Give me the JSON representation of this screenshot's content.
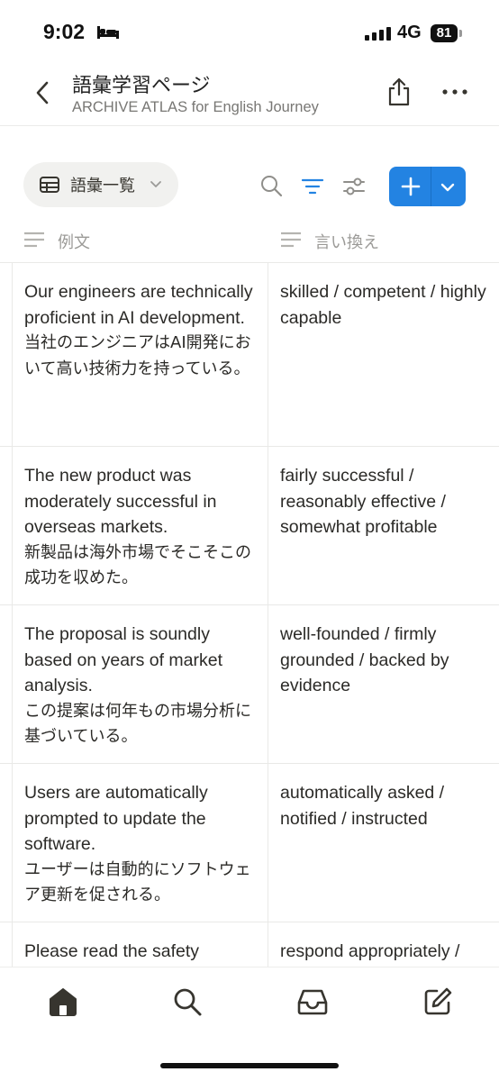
{
  "status_bar": {
    "time": "9:02",
    "network": "4G",
    "battery": "81"
  },
  "header": {
    "title": "語彙学習ページ",
    "subtitle": "ARCHIVE ATLAS for English Journey"
  },
  "view": {
    "name": "語彙一覧"
  },
  "columns": [
    {
      "label": "例文"
    },
    {
      "label": "言い換え"
    }
  ],
  "rows": [
    {
      "example_en": "Our engineers are technically proficient in AI development.",
      "example_ja": "当社のエンジニアはAI開発において高い技術力を持っている。",
      "paraphrase": "skilled / competent / highly capable"
    },
    {
      "example_en": "The new product was moderately successful in overseas markets.",
      "example_ja": "新製品は海外市場でそこそこの成功を収めた。",
      "paraphrase": "fairly successful / reasonably effective / somewhat profitable"
    },
    {
      "example_en": "The proposal is soundly based on years of market analysis.",
      "example_ja": "この提案は何年もの市場分析に基づいている。",
      "paraphrase": "well-founded / firmly grounded / backed by evidence"
    },
    {
      "example_en": "Users are automatically prompted to update the software.",
      "example_ja": "ユーザーは自動的にソフトウェア更新を促される。",
      "paraphrase": "automatically asked / notified / instructed"
    },
    {
      "example_en": "Please read the safety",
      "example_ja": "",
      "paraphrase": "respond appropriately /"
    }
  ],
  "colors": {
    "accent": "#2383e2",
    "text": "#37352f",
    "muted": "#9b9a97"
  },
  "icons": {
    "tabbar": [
      "home-icon",
      "search-icon",
      "inbox-icon",
      "compose-icon"
    ]
  }
}
